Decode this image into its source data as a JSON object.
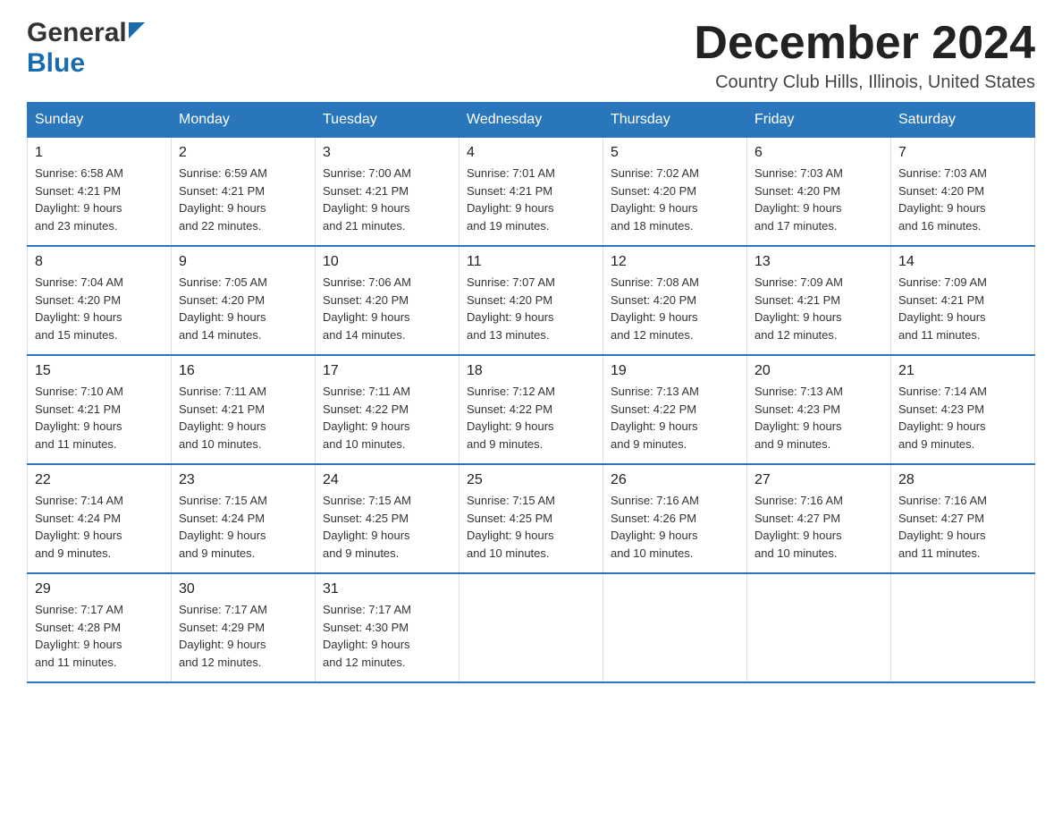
{
  "header": {
    "logo_general": "General",
    "logo_blue": "Blue",
    "title": "December 2024",
    "subtitle": "Country Club Hills, Illinois, United States"
  },
  "calendar": {
    "days_of_week": [
      "Sunday",
      "Monday",
      "Tuesday",
      "Wednesday",
      "Thursday",
      "Friday",
      "Saturday"
    ],
    "weeks": [
      [
        {
          "day": "1",
          "sunrise": "6:58 AM",
          "sunset": "4:21 PM",
          "daylight": "9 hours and 23 minutes."
        },
        {
          "day": "2",
          "sunrise": "6:59 AM",
          "sunset": "4:21 PM",
          "daylight": "9 hours and 22 minutes."
        },
        {
          "day": "3",
          "sunrise": "7:00 AM",
          "sunset": "4:21 PM",
          "daylight": "9 hours and 21 minutes."
        },
        {
          "day": "4",
          "sunrise": "7:01 AM",
          "sunset": "4:21 PM",
          "daylight": "9 hours and 19 minutes."
        },
        {
          "day": "5",
          "sunrise": "7:02 AM",
          "sunset": "4:20 PM",
          "daylight": "9 hours and 18 minutes."
        },
        {
          "day": "6",
          "sunrise": "7:03 AM",
          "sunset": "4:20 PM",
          "daylight": "9 hours and 17 minutes."
        },
        {
          "day": "7",
          "sunrise": "7:03 AM",
          "sunset": "4:20 PM",
          "daylight": "9 hours and 16 minutes."
        }
      ],
      [
        {
          "day": "8",
          "sunrise": "7:04 AM",
          "sunset": "4:20 PM",
          "daylight": "9 hours and 15 minutes."
        },
        {
          "day": "9",
          "sunrise": "7:05 AM",
          "sunset": "4:20 PM",
          "daylight": "9 hours and 14 minutes."
        },
        {
          "day": "10",
          "sunrise": "7:06 AM",
          "sunset": "4:20 PM",
          "daylight": "9 hours and 14 minutes."
        },
        {
          "day": "11",
          "sunrise": "7:07 AM",
          "sunset": "4:20 PM",
          "daylight": "9 hours and 13 minutes."
        },
        {
          "day": "12",
          "sunrise": "7:08 AM",
          "sunset": "4:20 PM",
          "daylight": "9 hours and 12 minutes."
        },
        {
          "day": "13",
          "sunrise": "7:09 AM",
          "sunset": "4:21 PM",
          "daylight": "9 hours and 12 minutes."
        },
        {
          "day": "14",
          "sunrise": "7:09 AM",
          "sunset": "4:21 PM",
          "daylight": "9 hours and 11 minutes."
        }
      ],
      [
        {
          "day": "15",
          "sunrise": "7:10 AM",
          "sunset": "4:21 PM",
          "daylight": "9 hours and 11 minutes."
        },
        {
          "day": "16",
          "sunrise": "7:11 AM",
          "sunset": "4:21 PM",
          "daylight": "9 hours and 10 minutes."
        },
        {
          "day": "17",
          "sunrise": "7:11 AM",
          "sunset": "4:22 PM",
          "daylight": "9 hours and 10 minutes."
        },
        {
          "day": "18",
          "sunrise": "7:12 AM",
          "sunset": "4:22 PM",
          "daylight": "9 hours and 9 minutes."
        },
        {
          "day": "19",
          "sunrise": "7:13 AM",
          "sunset": "4:22 PM",
          "daylight": "9 hours and 9 minutes."
        },
        {
          "day": "20",
          "sunrise": "7:13 AM",
          "sunset": "4:23 PM",
          "daylight": "9 hours and 9 minutes."
        },
        {
          "day": "21",
          "sunrise": "7:14 AM",
          "sunset": "4:23 PM",
          "daylight": "9 hours and 9 minutes."
        }
      ],
      [
        {
          "day": "22",
          "sunrise": "7:14 AM",
          "sunset": "4:24 PM",
          "daylight": "9 hours and 9 minutes."
        },
        {
          "day": "23",
          "sunrise": "7:15 AM",
          "sunset": "4:24 PM",
          "daylight": "9 hours and 9 minutes."
        },
        {
          "day": "24",
          "sunrise": "7:15 AM",
          "sunset": "4:25 PM",
          "daylight": "9 hours and 9 minutes."
        },
        {
          "day": "25",
          "sunrise": "7:15 AM",
          "sunset": "4:25 PM",
          "daylight": "9 hours and 10 minutes."
        },
        {
          "day": "26",
          "sunrise": "7:16 AM",
          "sunset": "4:26 PM",
          "daylight": "9 hours and 10 minutes."
        },
        {
          "day": "27",
          "sunrise": "7:16 AM",
          "sunset": "4:27 PM",
          "daylight": "9 hours and 10 minutes."
        },
        {
          "day": "28",
          "sunrise": "7:16 AM",
          "sunset": "4:27 PM",
          "daylight": "9 hours and 11 minutes."
        }
      ],
      [
        {
          "day": "29",
          "sunrise": "7:17 AM",
          "sunset": "4:28 PM",
          "daylight": "9 hours and 11 minutes."
        },
        {
          "day": "30",
          "sunrise": "7:17 AM",
          "sunset": "4:29 PM",
          "daylight": "9 hours and 12 minutes."
        },
        {
          "day": "31",
          "sunrise": "7:17 AM",
          "sunset": "4:30 PM",
          "daylight": "9 hours and 12 minutes."
        },
        null,
        null,
        null,
        null
      ]
    ],
    "labels": {
      "sunrise": "Sunrise: ",
      "sunset": "Sunset: ",
      "daylight": "Daylight: "
    }
  }
}
